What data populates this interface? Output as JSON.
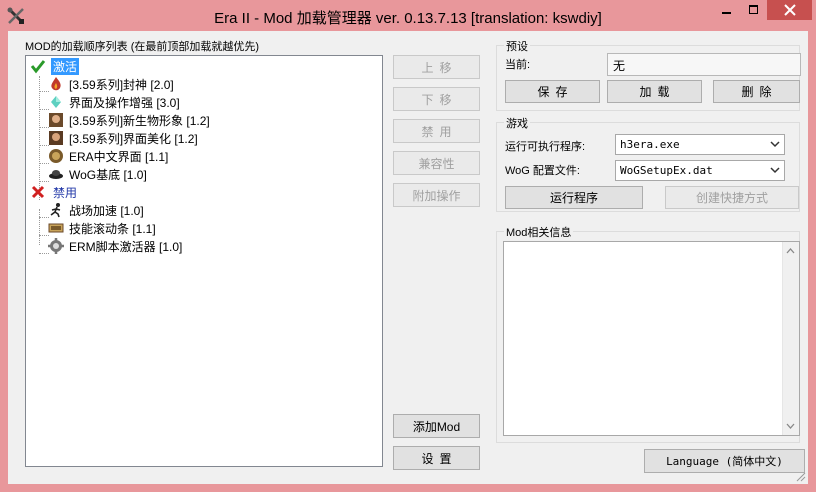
{
  "window": {
    "title": "Era II - Mod 加载管理器 ver. 0.13.7.13 [translation: kswdiy]"
  },
  "mod_list": {
    "label": "MOD的加载顺序列表 (在最前顶部加载就越优先)",
    "active_group": "激活",
    "disabled_group": "禁用",
    "active_items": [
      {
        "label": "[3.59系列]封神 [2.0]",
        "icon": "flame-icon"
      },
      {
        "label": "界面及操作增强 [3.0]",
        "icon": "crystal-icon"
      },
      {
        "label": "[3.59系列]新生物形象 [1.2]",
        "icon": "portrait-icon"
      },
      {
        "label": "[3.59系列]界面美化 [1.2]",
        "icon": "portrait-icon"
      },
      {
        "label": "ERA中文界面 [1.1]",
        "icon": "coin-icon"
      },
      {
        "label": "WoG基底 [1.0]",
        "icon": "hat-icon"
      }
    ],
    "disabled_items": [
      {
        "label": "战场加速 [1.0]",
        "icon": "runner-icon"
      },
      {
        "label": "技能滚动条 [1.1]",
        "icon": "scroll-icon"
      },
      {
        "label": "ERM脚本激活器 [1.0]",
        "icon": "gear-icon"
      }
    ]
  },
  "actions": {
    "up": "上移",
    "down": "下移",
    "disable": "禁用",
    "compat": "兼容性",
    "extra": "附加操作",
    "add_mod": "添加Mod",
    "settings": "设置"
  },
  "preset": {
    "title": "预设",
    "current_label": "当前:",
    "current_value": "无",
    "save": "保存",
    "load": "加载",
    "delete": "删除"
  },
  "game": {
    "title": "游戏",
    "exe_label": "运行可执行程序:",
    "exe_value": "h3era.exe",
    "wog_label": "WoG 配置文件:",
    "wog_value": "WoGSetupEx.dat",
    "run": "运行程序",
    "shortcut": "创建快捷方式"
  },
  "info": {
    "title": "Mod相关信息"
  },
  "language_button": "Language (简体中文)",
  "colors": {
    "titlebar": "#e8979b",
    "selection": "#3399ff",
    "close": "#c7504f"
  }
}
